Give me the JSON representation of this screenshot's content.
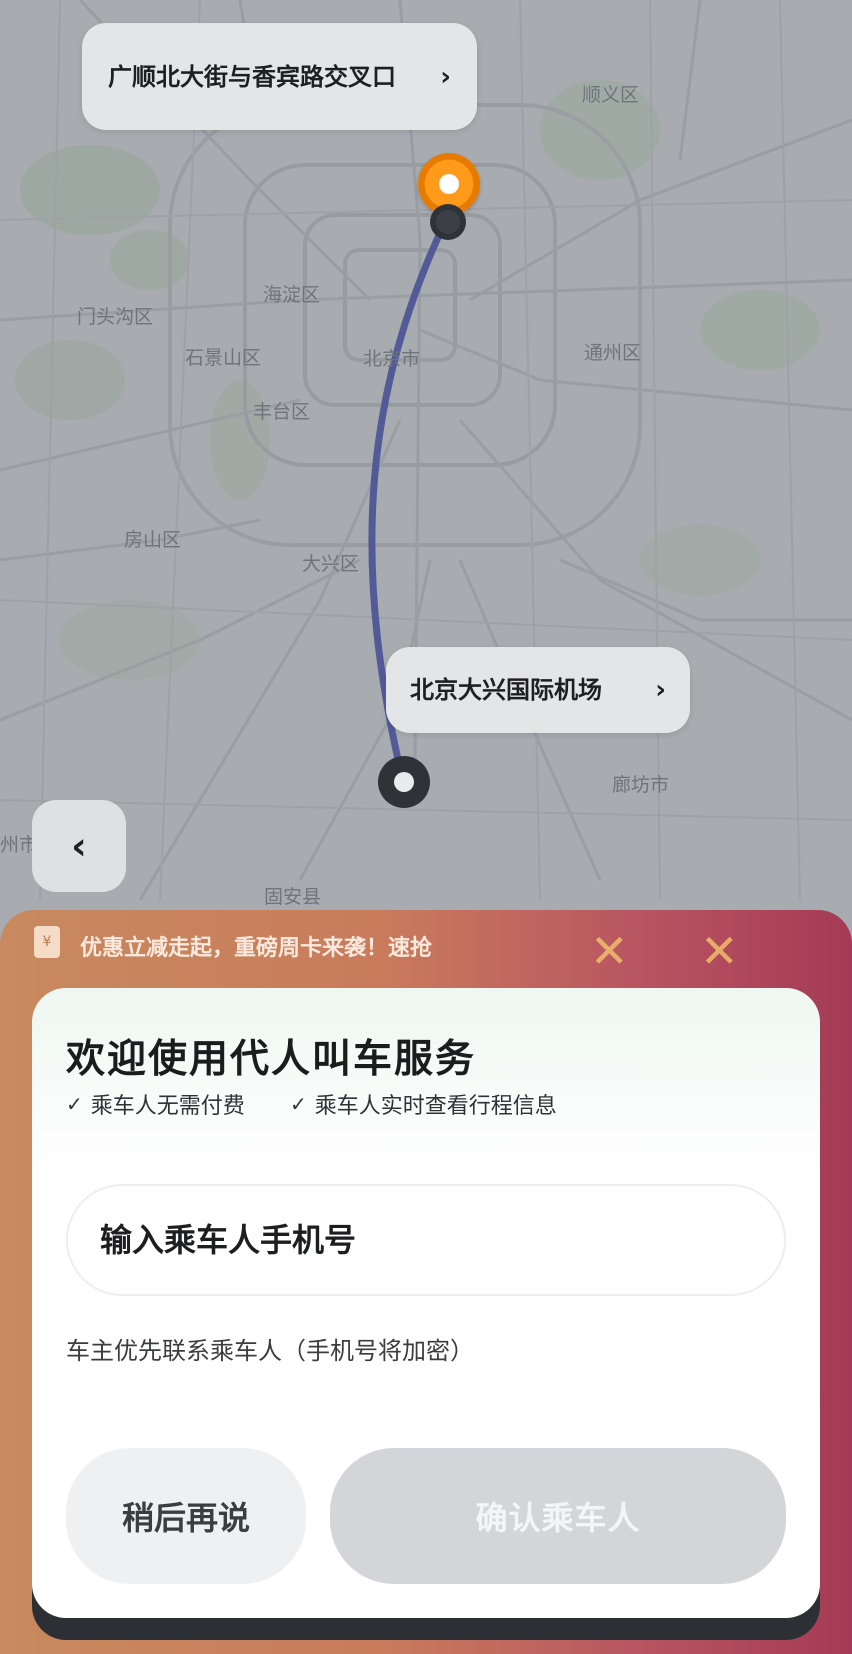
{
  "map": {
    "districts": [
      "顺义区",
      "海淀区",
      "门头沟区",
      "石景山区",
      "北京市",
      "通州区",
      "丰台区",
      "房山区",
      "大兴区",
      "廊坊市",
      "固安县",
      "州市"
    ],
    "start_label": "广顺北大街与香宾路交叉口",
    "end_label": "北京大兴国际机场",
    "route_color": "#5b67c9",
    "start_color": "#ff9a1a"
  },
  "icons": {
    "back": "chevron-left-icon",
    "start_chevron": "chevron-right-icon",
    "end_chevron": "chevron-right-icon",
    "promo": "coupon-icon",
    "check": "check-icon"
  },
  "promo": {
    "text": "优惠立减走起，重磅周卡来袭！速抢"
  },
  "modal": {
    "title": "欢迎使用代人叫车服务",
    "features": [
      "乘车人无需付费",
      "乘车人实时查看行程信息"
    ],
    "phone_placeholder": "输入乘车人手机号",
    "hint": "车主优先联系乘车人（手机号将加密）",
    "later_button": "稍后再说",
    "confirm_button": "确认乘车人"
  }
}
